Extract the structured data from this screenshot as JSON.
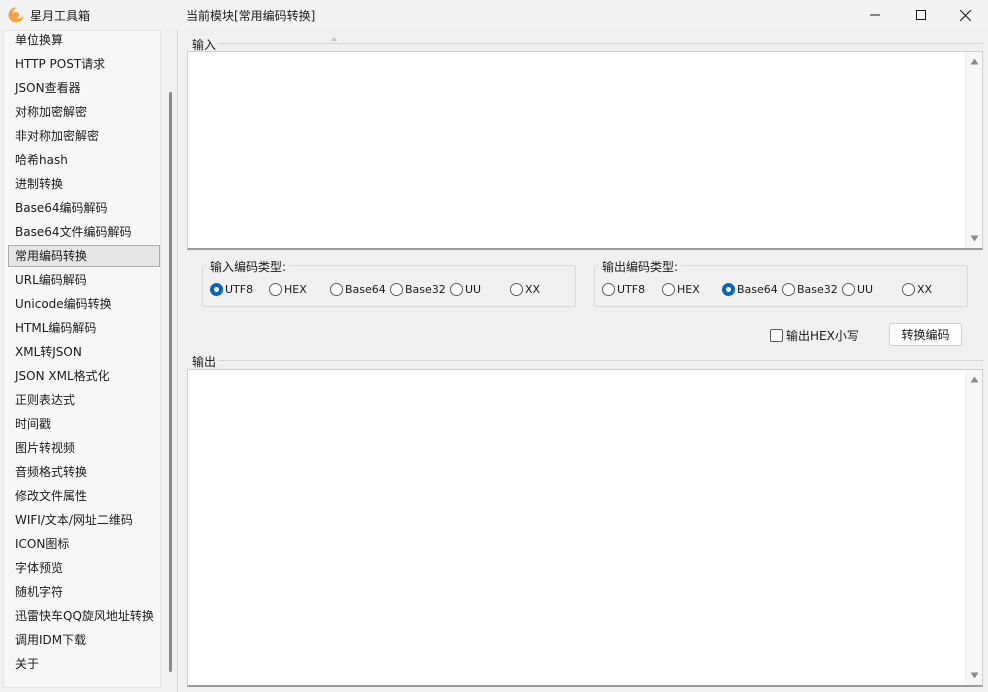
{
  "window": {
    "app_title": "星月工具箱",
    "module_title": "当前模块[常用编码转换]"
  },
  "sidebar": {
    "items": [
      {
        "label": "单位换算"
      },
      {
        "label": "HTTP POST请求"
      },
      {
        "label": "JSON查看器"
      },
      {
        "label": "对称加密解密"
      },
      {
        "label": "非对称加密解密"
      },
      {
        "label": "哈希hash"
      },
      {
        "label": "进制转换"
      },
      {
        "label": "Base64编码解码"
      },
      {
        "label": "Base64文件编码解码"
      },
      {
        "label": "常用编码转换",
        "selected": true
      },
      {
        "label": "URL编码解码"
      },
      {
        "label": "Unicode编码转换"
      },
      {
        "label": "HTML编码解码"
      },
      {
        "label": "XML转JSON"
      },
      {
        "label": "JSON XML格式化"
      },
      {
        "label": "正则表达式"
      },
      {
        "label": "时间戳"
      },
      {
        "label": "图片转视频"
      },
      {
        "label": "音频格式转换"
      },
      {
        "label": "修改文件属性"
      },
      {
        "label": "WIFI/文本/网址二维码"
      },
      {
        "label": "ICON图标"
      },
      {
        "label": "字体预览"
      },
      {
        "label": "随机字符"
      },
      {
        "label": "迅雷快车QQ旋风地址转换"
      },
      {
        "label": "调用IDM下载"
      },
      {
        "label": "关于"
      }
    ]
  },
  "input_section": {
    "label": "输入",
    "value": ""
  },
  "input_encoding": {
    "legend": "输入编码类型:",
    "options": [
      "UTF8",
      "HEX",
      "Base64",
      "Base32",
      "UU",
      "XX"
    ],
    "selected": "UTF8"
  },
  "output_encoding": {
    "legend": "输出编码类型:",
    "options": [
      "UTF8",
      "HEX",
      "Base64",
      "Base32",
      "UU",
      "XX"
    ],
    "selected": "Base64"
  },
  "options": {
    "hex_lowercase_label": "输出HEX小写",
    "hex_lowercase_checked": false
  },
  "convert_button": {
    "label": "转换编码"
  },
  "output_section": {
    "label": "输出",
    "value": ""
  },
  "colors": {
    "accent": "#0067c0",
    "logo": "#f2a33a"
  },
  "icons": {
    "app": "crescent-moon-logo",
    "minimize": "minimize-icon",
    "maximize": "maximize-icon",
    "close": "close-icon"
  }
}
